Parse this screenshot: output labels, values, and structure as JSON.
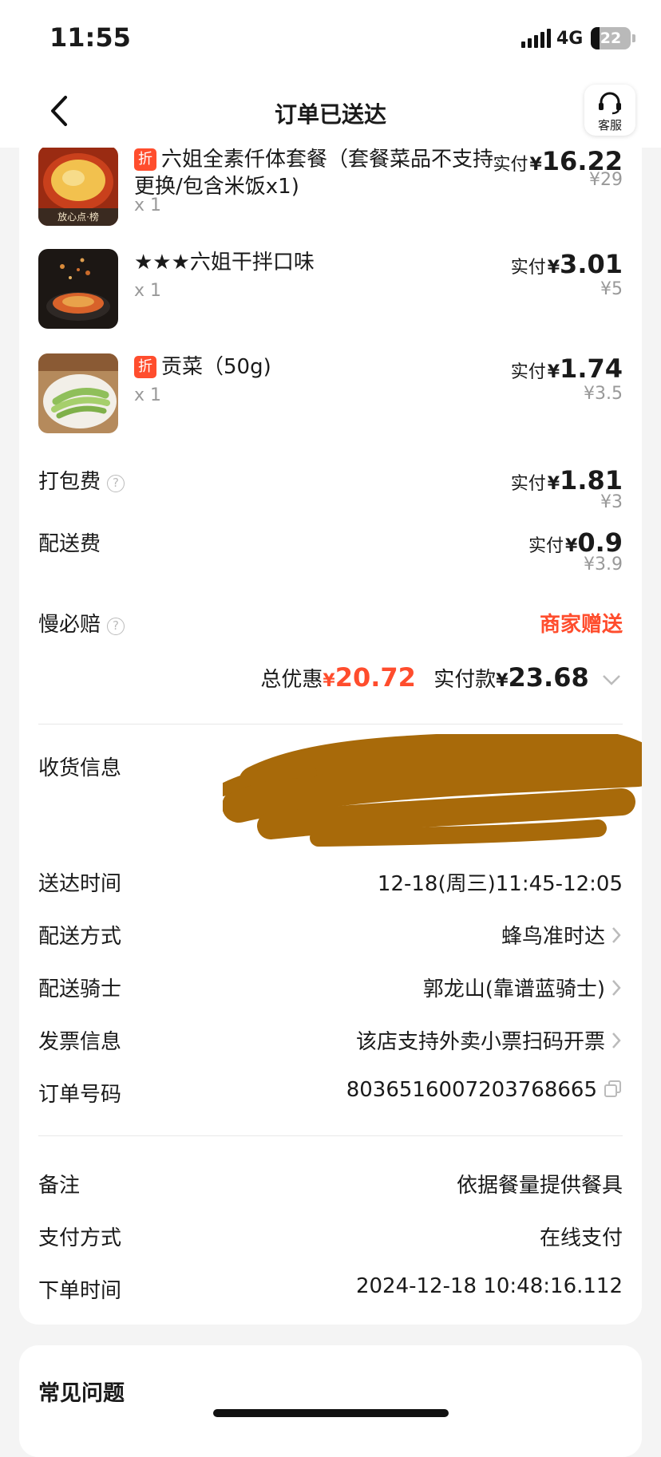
{
  "status_bar": {
    "time": "11:55",
    "network": "4G",
    "battery": "22",
    "battery_level": 0.22
  },
  "nav": {
    "title": "订单已送达",
    "service_label": "客服"
  },
  "items": [
    {
      "tag": "折",
      "name": "六姐全素仟体套餐（套餐菜品不支持更换/包含米饭x1)",
      "qty": "x 1",
      "pay_label": "实付",
      "currency": "¥",
      "paid": "16.22",
      "original": "¥29",
      "thumb_caption": "放心点·榜"
    },
    {
      "tag": "",
      "name": "★★★六姐干拌口味",
      "qty": "x 1",
      "pay_label": "实付",
      "currency": "¥",
      "paid": "3.01",
      "original": "¥5"
    },
    {
      "tag": "折",
      "name": "贡菜（50g)",
      "qty": "x 1",
      "pay_label": "实付",
      "currency": "¥",
      "paid": "1.74",
      "original": "¥3.5"
    }
  ],
  "fees": {
    "packing": {
      "label": "打包费",
      "pay_label": "实付",
      "currency": "¥",
      "paid": "1.81",
      "original": "¥3"
    },
    "delivery": {
      "label": "配送费",
      "pay_label": "实付",
      "currency": "¥",
      "paid": "0.9",
      "original": "¥3.9"
    },
    "late_guarantee": {
      "label": "慢必赔",
      "value": "商家赠送"
    }
  },
  "summary": {
    "discount_label": "总优惠",
    "discount_currency": "¥",
    "discount": "20.72",
    "paid_label": "实付款",
    "paid_currency": "¥",
    "paid": "23.68"
  },
  "delivery_info": {
    "receiver_label": "收货信息",
    "rows": [
      {
        "label": "送达时间",
        "value": "12-18(周三)11:45-12:05"
      },
      {
        "label": "配送方式",
        "value": "蜂鸟准时达"
      },
      {
        "label": "配送骑士",
        "value": "郭龙山(靠谱蓝骑士)"
      },
      {
        "label": "发票信息",
        "value": "该店支持外卖小票扫码开票"
      },
      {
        "label": "订单号码",
        "value": "8036516007203768665"
      }
    ]
  },
  "order_info": [
    {
      "label": "备注",
      "value": "依据餐量提供餐具"
    },
    {
      "label": "支付方式",
      "value": "在线支付"
    },
    {
      "label": "下单时间",
      "value": "2024-12-18 10:48:16.112"
    }
  ],
  "faq": {
    "title": "常见问题"
  },
  "colors": {
    "accent_red": "#ff4d2d",
    "redaction": "#a86a0a"
  }
}
